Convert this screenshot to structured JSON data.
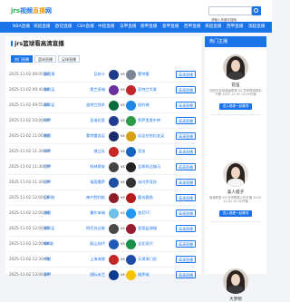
{
  "header": {
    "logo": {
      "part1": "jrs",
      "part2": "视频",
      "part3": "直播",
      "part4": "网"
    },
    "search": {
      "placeholder": "",
      "value": "请输入关键字搜索"
    }
  },
  "nav": [
    "NBA直播",
    "英超直播",
    "欧冠直播",
    "CBA直播",
    "中超直播",
    "法甲直播",
    "德甲直播",
    "意甲直播",
    "西甲直播",
    "英超直播",
    "西甲直播",
    "澳超直播"
  ],
  "main": {
    "title": "jrs篮球看高清直播",
    "tabs": [
      "热门直播",
      "篮球直播",
      "足球直播"
    ],
    "live_label": "高清直播",
    "vs": "vs",
    "matches": [
      {
        "time": "2025-11-02 09:05:00",
        "league": "墨西哥",
        "home": "瓦哈卡",
        "away": "蒙特雷",
        "hc": "#1e3a8a",
        "ac": "#7a8696"
      },
      {
        "time": "2025-11-02 09:40:00",
        "league": "美职足",
        "home": "奥兰多城",
        "away": "亚特兰大联",
        "hc": "#6b2fa1",
        "ac": "#c1272d"
      },
      {
        "time": "2025-11-02 09:55:00",
        "league": "美职足",
        "home": "波特兰伐木",
        "away": "纽约城",
        "hc": "#0b6b3a",
        "ac": "#1e88e5"
      },
      {
        "time": "2025-11-02 10:00:00",
        "league": "阿甲",
        "home": "圣洛伦索",
        "away": "罗萨里奥中央",
        "hc": "#1f3e8f",
        "ac": "#2d9a47"
      },
      {
        "time": "2025-11-02 11:00:00",
        "league": "墨超",
        "home": "蒙特雷女足",
        "away": "瓜达拉哈拉女足",
        "hc": "#1c2a6b",
        "ac": "#d4a017"
      },
      {
        "time": "2025-11-02 11:30:00",
        "league": "阿甲",
        "home": "独立队",
        "away": "竞技",
        "hc": "#c62828",
        "ac": "#1565c0"
      },
      {
        "time": "2025-11-02 11:30:00",
        "league": "巴甲",
        "home": "科林蒂安",
        "away": "瓦斯科达伽马",
        "hc": "#444444",
        "ac": "#222222"
      },
      {
        "time": "2025-11-02 11:30:00",
        "league": "巴甲",
        "home": "福塔雷萨",
        "away": "米内罗竞技",
        "hc": "#1d4fa3",
        "ac": "#333333"
      },
      {
        "time": "2025-11-02 12:00:00",
        "league": "日职联",
        "home": "神户胜利船",
        "away": "鹿岛鹿角",
        "hc": "#8e1d2c",
        "ac": "#b71c1c"
      },
      {
        "time": "2025-11-02 12:00:00",
        "league": "澳超",
        "home": "墨尔本城",
        "away": "悉尼FC",
        "hc": "#6ec1e4",
        "ac": "#2196f3"
      },
      {
        "time": "2025-11-02 12:00:00",
        "league": "美职足",
        "home": "明尼苏达联",
        "away": "皇家盐湖城",
        "hc": "#4a4a4a",
        "ac": "#9a1b2f"
      },
      {
        "time": "2025-11-02 12:00:00",
        "league": "韩K联",
        "home": "蔚山现代",
        "away": "全北现代",
        "hc": "#1e5bb8",
        "ac": "#1a8f4a"
      },
      {
        "time": "2025-11-02 12:30:00",
        "league": "中超",
        "home": "上海海港",
        "away": "天津津门虎",
        "hc": "#c62828",
        "ac": "#1e4aa8"
      },
      {
        "time": "2025-11-02 13:00:00",
        "league": "意甲",
        "home": "国际米兰",
        "away": "维罗纳",
        "hc": "#0a3d91",
        "ac": "#f5c400"
      }
    ]
  },
  "sidebar": {
    "title": "热门主播",
    "enter_label": "进入观看一起看球",
    "anchors": [
      {
        "name": "花伍",
        "desc": "西班牙足球超级联赛 VS 意甲联赛精彩不断 2025-11-02 13:00开播"
      },
      {
        "name": "美人搭子",
        "desc": "英超联赛 VS 法甲联赛火热开播 2025-11-02 14:30开播"
      },
      {
        "name": "大梦想",
        "desc": ""
      }
    ]
  }
}
